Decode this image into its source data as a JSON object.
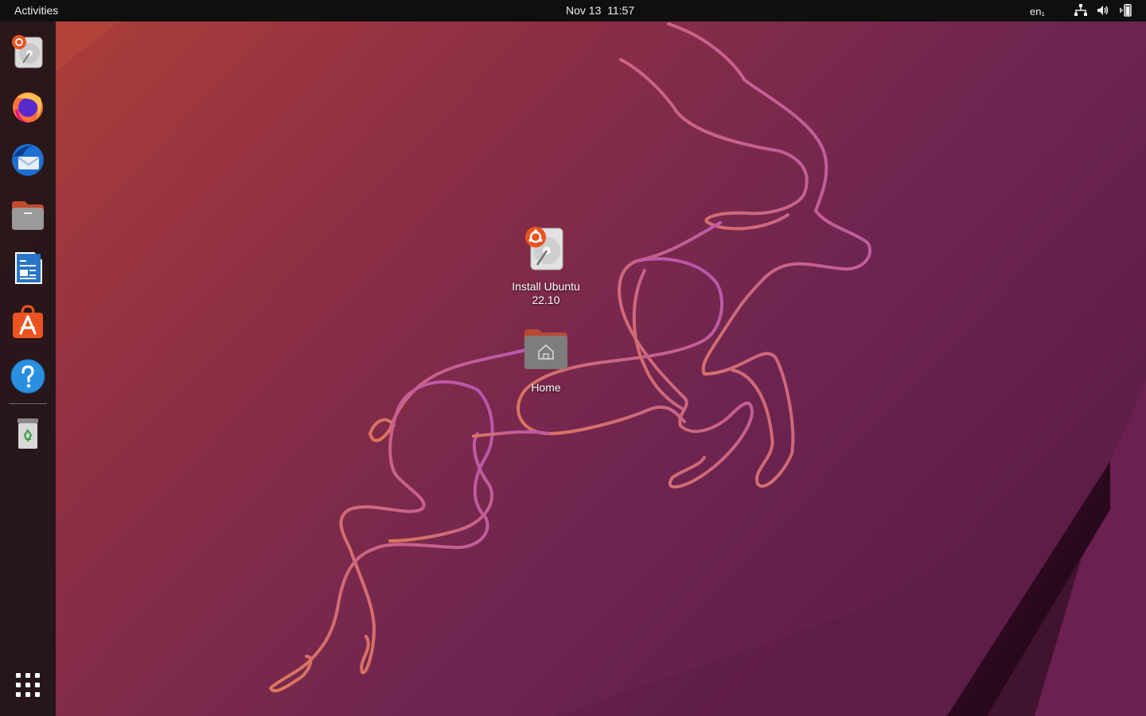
{
  "topbar": {
    "activities_label": "Activities",
    "clock": "Nov 13  11:57",
    "input_language": "en₁",
    "tray_icons": [
      "network-icon",
      "volume-icon",
      "battery-icon"
    ]
  },
  "dock": {
    "apps": [
      {
        "id": "install-ubuntu",
        "icon": "installer-icon"
      },
      {
        "id": "firefox",
        "icon": "firefox-icon"
      },
      {
        "id": "thunderbird",
        "icon": "thunderbird-icon"
      },
      {
        "id": "files",
        "icon": "files-icon"
      },
      {
        "id": "libreoffice-writer",
        "icon": "writer-icon"
      },
      {
        "id": "ubuntu-software",
        "icon": "software-icon"
      },
      {
        "id": "help",
        "icon": "help-icon"
      },
      {
        "id": "trash",
        "icon": "trash-icon"
      }
    ],
    "show_apps_icon": "app-grid-icon"
  },
  "desktop": {
    "icons": [
      {
        "id": "install-ubuntu",
        "label_line1": "Install Ubuntu",
        "label_line2": "22.10"
      },
      {
        "id": "home",
        "label_line1": "Home"
      }
    ]
  },
  "colors": {
    "wallpaper_left": "#a33a3a",
    "wallpaper_right": "#6b2452",
    "ubuntu_orange": "#e95420",
    "topbar": "#0f0f0f"
  }
}
